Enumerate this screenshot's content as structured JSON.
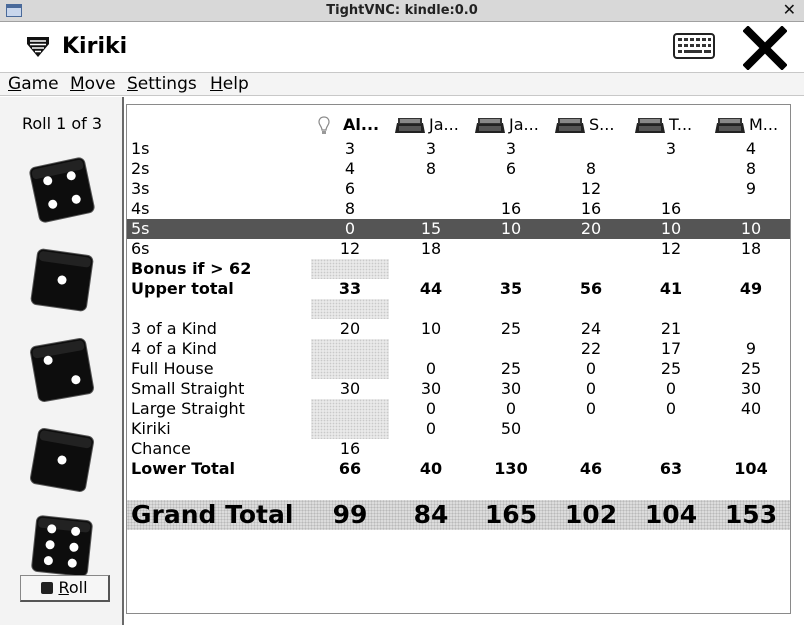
{
  "window": {
    "title": "TightVNC: kindle:0.0",
    "close_glyph": "✕"
  },
  "app": {
    "name": "Kiriki",
    "logo_icon": "shield-icon",
    "keyboard_icon": "keyboard-icon",
    "close_icon": "close-icon"
  },
  "menu": [
    {
      "label": "Game",
      "mnemonic": "G",
      "rest": "ame"
    },
    {
      "label": "Move",
      "mnemonic": "M",
      "rest": "ove"
    },
    {
      "label": "Settings",
      "mnemonic": "S",
      "rest": "ettings"
    },
    {
      "label": "Help",
      "mnemonic": "H",
      "rest": "elp"
    }
  ],
  "dice": {
    "roll_status": "Roll 1 of 3",
    "values": [
      4,
      1,
      2,
      1,
      6
    ],
    "roll_button": {
      "mnemonic": "R",
      "rest": "oll",
      "label": "Roll"
    }
  },
  "players": [
    {
      "name": "Al...",
      "icon": "lightbulb-icon",
      "active": true
    },
    {
      "name": "Ja...",
      "icon": "ereader-icon",
      "active": false
    },
    {
      "name": "Ja...",
      "icon": "ereader-icon",
      "active": false
    },
    {
      "name": "S...",
      "icon": "ereader-icon",
      "active": false
    },
    {
      "name": "T...",
      "icon": "ereader-icon",
      "active": false
    },
    {
      "name": "M...",
      "icon": "ereader-icon",
      "active": false
    }
  ],
  "rows": [
    {
      "label": "1s",
      "values": [
        "3",
        "3",
        "3",
        "",
        "3",
        "4"
      ]
    },
    {
      "label": "2s",
      "values": [
        "4",
        "8",
        "6",
        "8",
        "",
        "8"
      ]
    },
    {
      "label": "3s",
      "values": [
        "6",
        "",
        "",
        "12",
        "",
        "9"
      ]
    },
    {
      "label": "4s",
      "values": [
        "8",
        "",
        "16",
        "16",
        "16",
        ""
      ]
    },
    {
      "label": "5s",
      "values": [
        "0",
        "15",
        "10",
        "20",
        "10",
        "10"
      ],
      "highlight": true
    },
    {
      "label": "6s",
      "values": [
        "12",
        "18",
        "",
        "",
        "12",
        "18"
      ]
    },
    {
      "label": "Bonus if > 62",
      "values": [
        "",
        "",
        "",
        "",
        "",
        ""
      ],
      "bold": true
    },
    {
      "label": "Upper total",
      "values": [
        "33",
        "44",
        "35",
        "56",
        "41",
        "49"
      ],
      "bold": true
    },
    {
      "label": "",
      "values": [
        "",
        "",
        "",
        "",
        "",
        ""
      ]
    },
    {
      "label": "3 of a Kind",
      "values": [
        "20",
        "10",
        "25",
        "24",
        "21",
        ""
      ]
    },
    {
      "label": "4 of a Kind",
      "values": [
        "",
        "",
        "",
        "22",
        "17",
        "9"
      ]
    },
    {
      "label": "Full House",
      "values": [
        "",
        "0",
        "25",
        "0",
        "25",
        "25"
      ]
    },
    {
      "label": "Small Straight",
      "values": [
        "30",
        "30",
        "30",
        "0",
        "0",
        "30"
      ]
    },
    {
      "label": "Large Straight",
      "values": [
        "",
        "0",
        "0",
        "0",
        "0",
        "40"
      ]
    },
    {
      "label": "Kiriki",
      "values": [
        "",
        "0",
        "50",
        "",
        "",
        ""
      ]
    },
    {
      "label": "Chance",
      "values": [
        "16",
        "",
        "",
        "",
        "",
        ""
      ]
    },
    {
      "label": "Lower Total",
      "values": [
        "66",
        "40",
        "130",
        "46",
        "63",
        "104"
      ],
      "bold": true
    }
  ],
  "grand_total": {
    "label": "Grand Total",
    "values": [
      "99",
      "84",
      "165",
      "102",
      "104",
      "153"
    ]
  }
}
